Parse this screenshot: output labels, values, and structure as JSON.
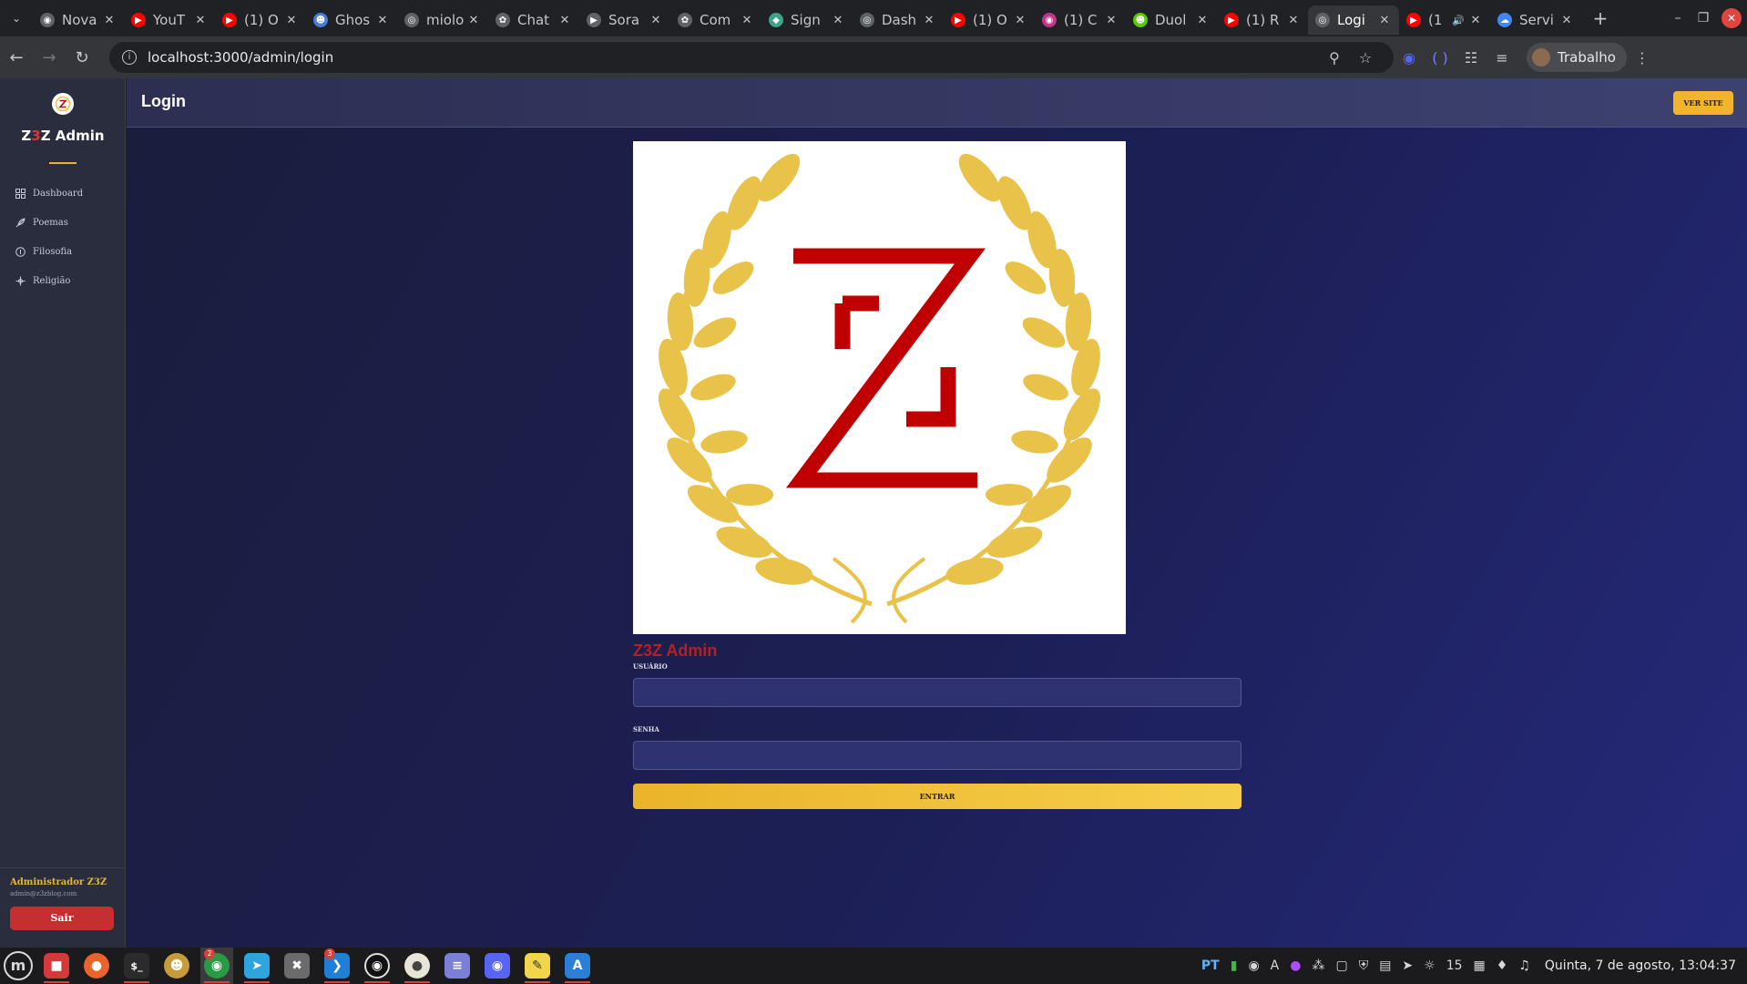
{
  "browser": {
    "tabs": [
      {
        "label": "Nova",
        "favicon": "chrome-icon",
        "color": "#5f6368"
      },
      {
        "label": "YouT",
        "favicon": "youtube-icon",
        "color": "#ff0000"
      },
      {
        "label": "(1) O",
        "favicon": "youtube-icon",
        "color": "#ff0000"
      },
      {
        "label": "Ghos",
        "favicon": "ghost-icon",
        "color": "#4a7bd6"
      },
      {
        "label": "miolo",
        "favicon": "globe-icon",
        "color": "#5f6368"
      },
      {
        "label": "Chat",
        "favicon": "openai-icon",
        "color": "#5f6368"
      },
      {
        "label": "Sora",
        "favicon": "sora-icon",
        "color": "#5f6368"
      },
      {
        "label": "Com",
        "favicon": "openai-icon",
        "color": "#5f6368"
      },
      {
        "label": "Sign",
        "favicon": "diamond-icon",
        "color": "#3aa58a"
      },
      {
        "label": "Dash",
        "favicon": "globe-icon",
        "color": "#5f6368"
      },
      {
        "label": "(1) O",
        "favicon": "youtube-icon",
        "color": "#ff0000"
      },
      {
        "label": "(1) C",
        "favicon": "instagram-icon",
        "color": "#c1358b"
      },
      {
        "label": "Duol",
        "favicon": "duolingo-icon",
        "color": "#58cc02"
      },
      {
        "label": "(1) R",
        "favicon": "youtube-icon",
        "color": "#ff0000"
      },
      {
        "label": "Logi",
        "favicon": "globe-icon",
        "color": "#5f6368",
        "active": true
      },
      {
        "label": "(1",
        "favicon": "youtube-icon",
        "color": "#ff0000",
        "audio": true
      },
      {
        "label": "Servi",
        "favicon": "cloud-icon",
        "color": "#4285f4"
      }
    ],
    "url": "localhost:3000/admin/login",
    "profile_name": "Trabalho"
  },
  "sidebar": {
    "title_prefix": "Z",
    "title_accent": "3",
    "title_suffix": "Z Admin",
    "items": [
      {
        "label": "Dashboard"
      },
      {
        "label": "Poemas"
      },
      {
        "label": "Filosofia"
      },
      {
        "label": "Religião"
      }
    ],
    "user_name": "Administrador Z3Z",
    "user_email": "admin@z3zblog.com",
    "logout_label": "Sair"
  },
  "header": {
    "title": "Login",
    "ver_site_label": "VER SITE"
  },
  "login": {
    "brand": "Z3Z Admin",
    "username_label": "USUÁRIO",
    "username_value": "",
    "password_label": "SENHA",
    "password_value": "",
    "submit_label": "ENTRAR"
  },
  "taskbar": {
    "chrome_badge": "2",
    "vscode_badge": "3",
    "lang": "PT",
    "notification_count": "15",
    "clock": "Quinta, 7 de agosto, 13:04:37"
  },
  "colors": {
    "accent_gold": "#f0b52d",
    "brand_red": "#b52020",
    "bg_navy": "#1c1f55"
  }
}
